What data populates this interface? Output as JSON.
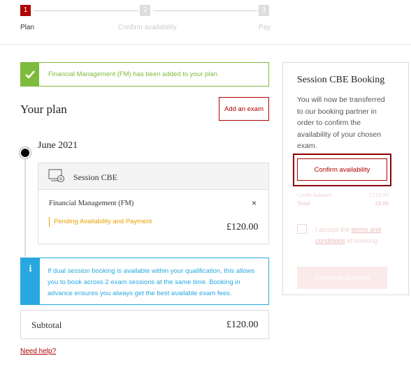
{
  "stepper": {
    "steps": [
      {
        "number": "1",
        "label": "Plan"
      },
      {
        "number": "2",
        "label": "Confirm availability"
      },
      {
        "number": "3",
        "label": "Pay"
      }
    ]
  },
  "success_banner": {
    "text": "Financial Management (FM) has been added to your plan."
  },
  "plan": {
    "title": "Your plan",
    "add_exam_label": "Add an exam",
    "month": "June 2021",
    "session_title": "Session CBE",
    "exam_name": "Financial Management (FM)",
    "remove_symbol": "×",
    "status": "Pending Availability and Payment",
    "price": "£120.00"
  },
  "info_box": {
    "icon_letter": "i",
    "text": "If dual session booking is available within your qualification, this allows you to book across 2 exam sessions at the same time. Booking in advance ensures you always get the best available exam fees."
  },
  "subtotal": {
    "label": "Subtotal",
    "value": "£120.00"
  },
  "need_help_label": "Need help?",
  "booking_panel": {
    "title": "Session CBE Booking",
    "description": "You will now be transferred to our booking partner in order to confirm the availability of your chosen exam.",
    "confirm_label": "Confirm availability",
    "credit_balance_label": "Credit balance",
    "credit_balance_value": "£120.00",
    "total_label": "Total",
    "total_value": "£0.00",
    "accept_prefix": "I accept the ",
    "accept_link": "terms and conditions",
    "accept_suffix": " of booking",
    "complete_label": "Complete Booking"
  },
  "colors": {
    "brand_red": "#b00000",
    "success_green": "#7dbb3c",
    "info_blue": "#29a8e0",
    "pending_orange": "#e8a000"
  }
}
